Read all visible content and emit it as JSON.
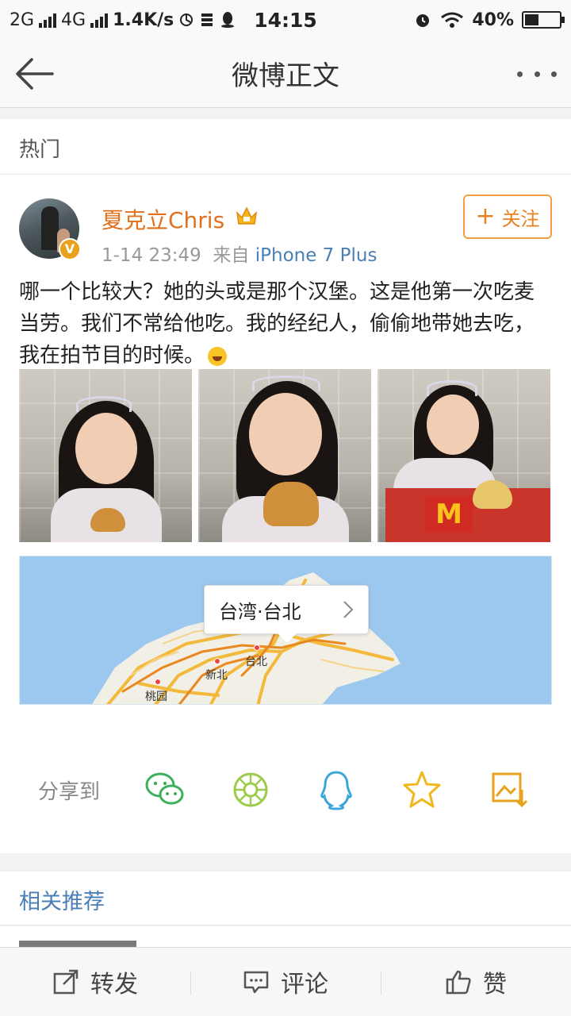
{
  "status_bar": {
    "network_1": "2G",
    "network_2": "4G",
    "speed": "1.4K/s",
    "time": "14:15",
    "battery_percent": "40%",
    "battery_level": 0.4
  },
  "nav": {
    "title": "微博正文"
  },
  "hot_label": "热门",
  "post": {
    "username": "夏克立Chris",
    "verified_badge": "V",
    "time": "1-14 23:49",
    "source_prefix": "来自",
    "device": "iPhone 7 Plus",
    "follow_plus": "+",
    "follow_label": "关注",
    "text": "哪一个比较大？她的头或是那个汉堡。这是他第一次吃麦当劳。我们不常给他吃。我的经纪人，偷偷地带她去吃，我在拍节目的时候。",
    "location": {
      "label": "台湾·台北",
      "cities": [
        "台北",
        "新北",
        "桃园"
      ]
    }
  },
  "share": {
    "label": "分享到",
    "icons": [
      "wechat-icon",
      "moments-icon",
      "qq-icon",
      "favorite-star-icon",
      "save-image-icon"
    ]
  },
  "related_label": "相关推荐",
  "bottom_bar": {
    "repost": "转发",
    "comment": "评论",
    "like": "赞"
  },
  "colors": {
    "username": "#e0701b",
    "link": "#4a7fb5",
    "follow": "#e8811e",
    "map_water": "#9cc8ef"
  }
}
